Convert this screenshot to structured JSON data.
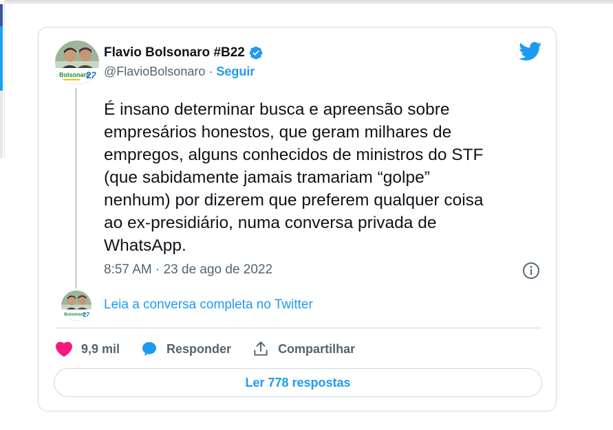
{
  "tweet": {
    "author_name": "Flavio Bolsonaro #B22",
    "handle": "@FlavioBolsonaro",
    "separator": "·",
    "follow_label": "Seguir",
    "avatar_caption": "Bolsonaro",
    "avatar_number": "22",
    "text": "É insano determinar busca e apreensão sobre\nempresários honestos, que geram milhares de\nempregos, alguns conhecidos de ministros do STF\n(que sabidamente jamais tramariam “golpe”\nnenhum) por dizerem que preferem qualquer coisa\nao ex-presidiário, numa conversa privada de\nWhatsApp.",
    "timestamp": "8:57 AM · 23 de ago de 2022",
    "read_thread_label": "Leia a conversa completa no Twitter",
    "likes": "9,9 mil",
    "reply_label": "Responder",
    "share_label": "Compartilhar",
    "read_replies_label": "Ler 778 respostas"
  },
  "colors": {
    "twitter_blue": "#1d9bf0",
    "like_pink": "#f91880",
    "text_dark": "#0f1419",
    "text_gray": "#536471",
    "border": "#cfd9de"
  },
  "icons": [
    "twitter-bird-icon",
    "verified-badge-icon",
    "info-icon",
    "heart-icon",
    "reply-bubble-icon",
    "share-icon"
  ]
}
